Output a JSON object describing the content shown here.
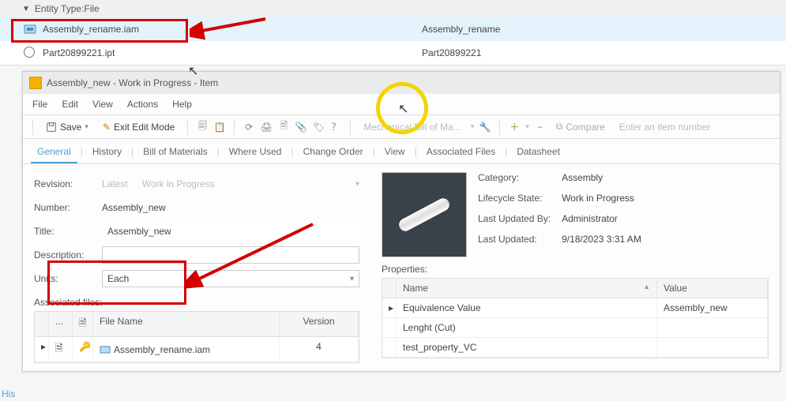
{
  "topList": {
    "header": "Entity Type:File",
    "rows": [
      {
        "name": "Assembly_rename.iam",
        "second": "Assembly_rename",
        "icon": "assembly"
      },
      {
        "name": "Part20899221.ipt",
        "second": "Part20899221",
        "icon": "part"
      }
    ]
  },
  "window": {
    "title": "Assembly_new - Work in Progress - Item"
  },
  "menu": {
    "file": "File",
    "edit": "Edit",
    "view": "View",
    "actions": "Actions",
    "help": "Help"
  },
  "toolbar": {
    "save": "Save",
    "exit": "Exit Edit Mode",
    "bom": "Mechanical Bill of Ma...",
    "compare": "Compare",
    "search_ph": "Enter an item number"
  },
  "tabs": {
    "general": "General",
    "history": "History",
    "bom": "Bill of Materials",
    "where": "Where Used",
    "change": "Change Order",
    "view": "View",
    "assoc": "Associated Files",
    "data": "Datasheet"
  },
  "form": {
    "revision_label": "Revision:",
    "rev_latest": "Latest",
    "rev_wip": "Work in Progress",
    "number_label": "Number:",
    "number_value": "Assembly_new",
    "title_label": "Title:",
    "title_value": "Assembly_new",
    "desc_label": "Description:",
    "desc_value": "",
    "units_label": "Units:",
    "units_value": "Each"
  },
  "assoc": {
    "header": "Associated files:",
    "col_file": "File Name",
    "col_ver": "Version",
    "row_file": "Assembly_rename.iam",
    "row_ver": "4"
  },
  "meta": {
    "category_l": "Category:",
    "category_v": "Assembly",
    "life_l": "Lifecycle State:",
    "life_v": "Work in Progress",
    "upd_by_l": "Last Updated By:",
    "upd_by_v": "Administrator",
    "upd_l": "Last Updated:",
    "upd_v": "9/18/2023 3:31 AM"
  },
  "props": {
    "header": "Properties:",
    "col_name": "Name",
    "col_value": "Value",
    "rows": [
      {
        "name": "Equivalence Value",
        "value": "Assembly_new"
      },
      {
        "name": "Lenght (Cut)",
        "value": ""
      },
      {
        "name": "test_property_VC",
        "value": ""
      }
    ]
  },
  "stub": {
    "his": "His"
  }
}
